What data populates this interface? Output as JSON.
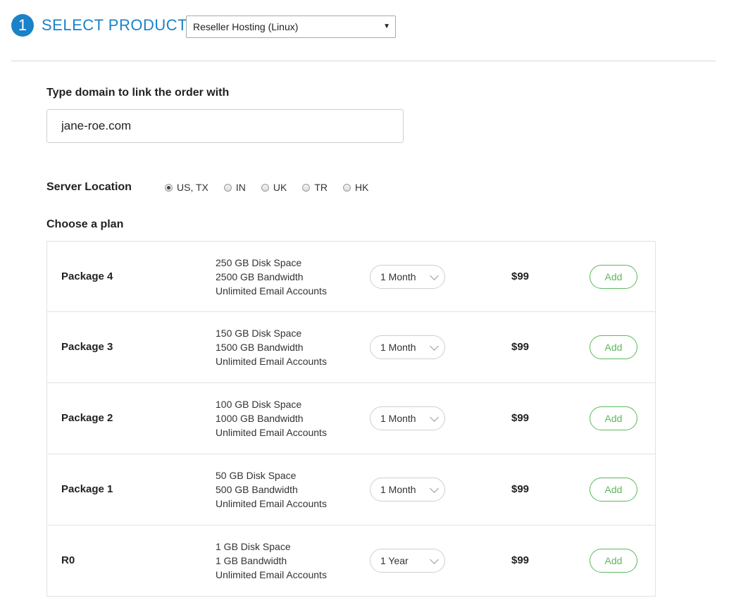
{
  "header": {
    "step_number": "1",
    "title": "SELECT PRODUCT:",
    "product_select": "Reseller Hosting (Linux)"
  },
  "domain": {
    "label": "Type domain to link the order with",
    "value": "jane-roe.com"
  },
  "location": {
    "label": "Server Location",
    "options": [
      {
        "label": "US, TX",
        "checked": true
      },
      {
        "label": "IN",
        "checked": false
      },
      {
        "label": "UK",
        "checked": false
      },
      {
        "label": "TR",
        "checked": false
      },
      {
        "label": "HK",
        "checked": false
      }
    ]
  },
  "plans": {
    "label": "Choose a plan",
    "items": [
      {
        "name": "Package 4",
        "disk": "250 GB Disk Space",
        "bandwidth": "2500 GB Bandwidth",
        "email": "Unlimited Email Accounts",
        "term": "1 Month",
        "price": "$99",
        "add": "Add"
      },
      {
        "name": "Package 3",
        "disk": "150 GB Disk Space",
        "bandwidth": "1500 GB Bandwidth",
        "email": "Unlimited Email Accounts",
        "term": "1 Month",
        "price": "$99",
        "add": "Add"
      },
      {
        "name": "Package 2",
        "disk": "100 GB Disk Space",
        "bandwidth": "1000 GB Bandwidth",
        "email": "Unlimited Email Accounts",
        "term": "1 Month",
        "price": "$99",
        "add": "Add"
      },
      {
        "name": "Package 1",
        "disk": "50 GB Disk Space",
        "bandwidth": "500 GB Bandwidth",
        "email": "Unlimited Email Accounts",
        "term": "1 Month",
        "price": "$99",
        "add": "Add"
      },
      {
        "name": "R0",
        "disk": "1 GB Disk Space",
        "bandwidth": "1 GB Bandwidth",
        "email": "Unlimited Email Accounts",
        "term": "1 Year",
        "price": "$99",
        "add": "Add"
      }
    ]
  },
  "colors": {
    "accent": "#1a82c8",
    "add_button": "#5cb85c"
  }
}
